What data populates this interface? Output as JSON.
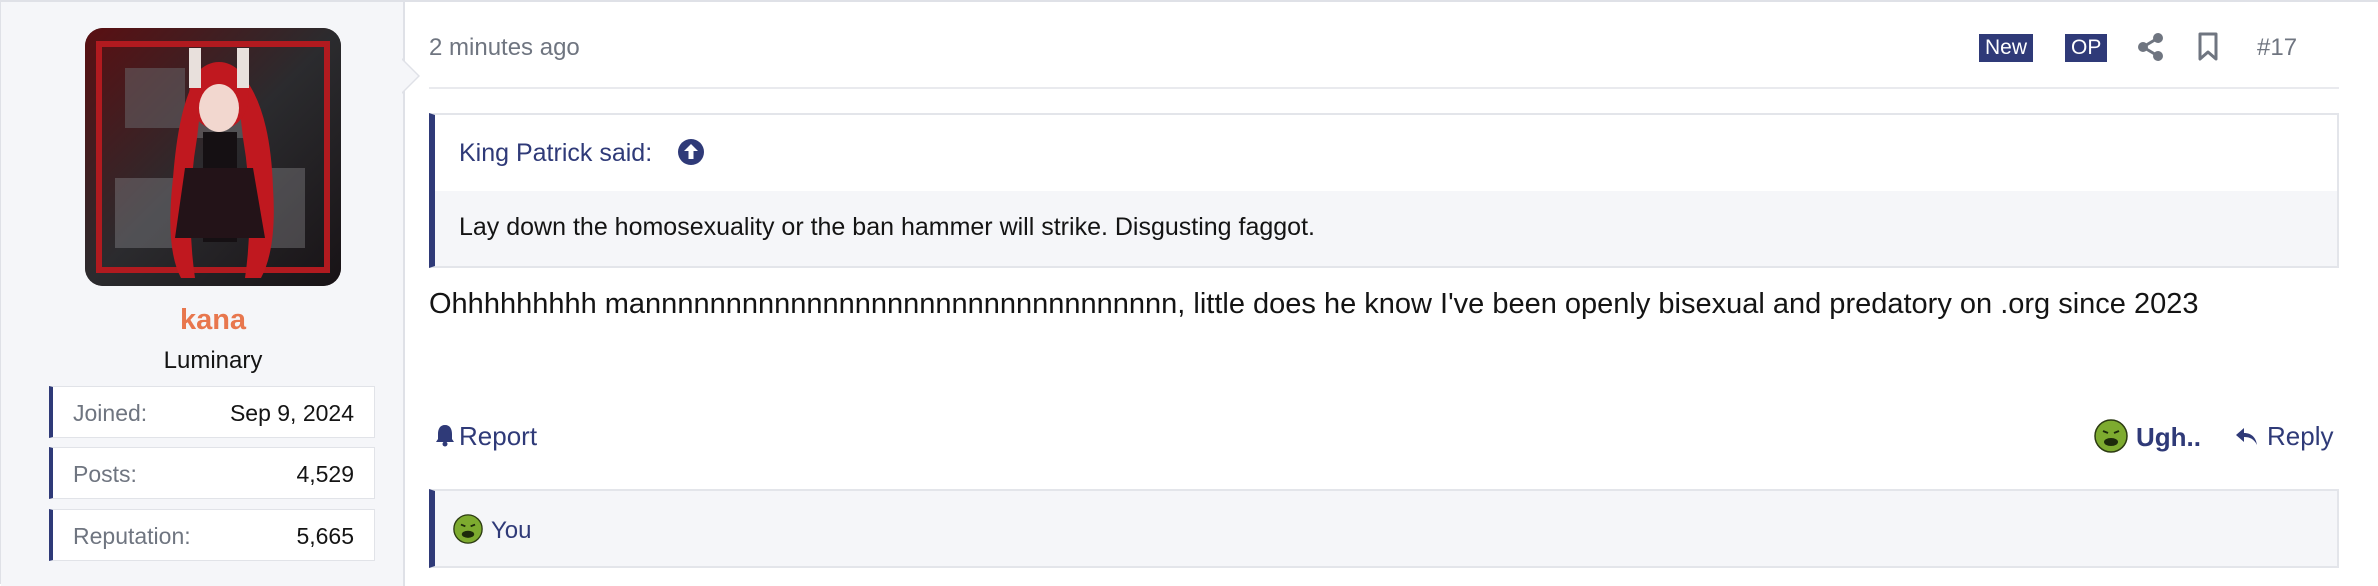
{
  "user": {
    "name": "kana",
    "title": "Luminary",
    "stats": [
      {
        "label": "Joined:",
        "value": "Sep 9, 2024"
      },
      {
        "label": "Posts:",
        "value": "4,529"
      },
      {
        "label": "Reputation:",
        "value": "5,665"
      }
    ]
  },
  "post": {
    "time": "2 minutes ago",
    "badges": {
      "new": "New",
      "op": "OP"
    },
    "number": "#17",
    "quote": {
      "author": "King Patrick said:",
      "text": "Lay down the homosexuality or the ban hammer will strike. Disgusting faggot."
    },
    "message": "Ohhhhhhhhh mannnnnnnnnnnnnnnnnnnnnnnnnnnnnnnnn, little does he know I've been openly bisexual and predatory on .org since 2023",
    "actions": {
      "report": "Report",
      "reaction": "Ugh..",
      "reply": "Reply"
    },
    "reactions_by": "You"
  },
  "colors": {
    "accent": "#2f3a78",
    "username": "#e8774e",
    "reaction": "#7dab2f"
  },
  "icons": [
    "share-icon",
    "bookmark-icon",
    "arrow-up-circle-icon",
    "bell-icon",
    "sick-face-icon",
    "reply-arrow-icon"
  ]
}
